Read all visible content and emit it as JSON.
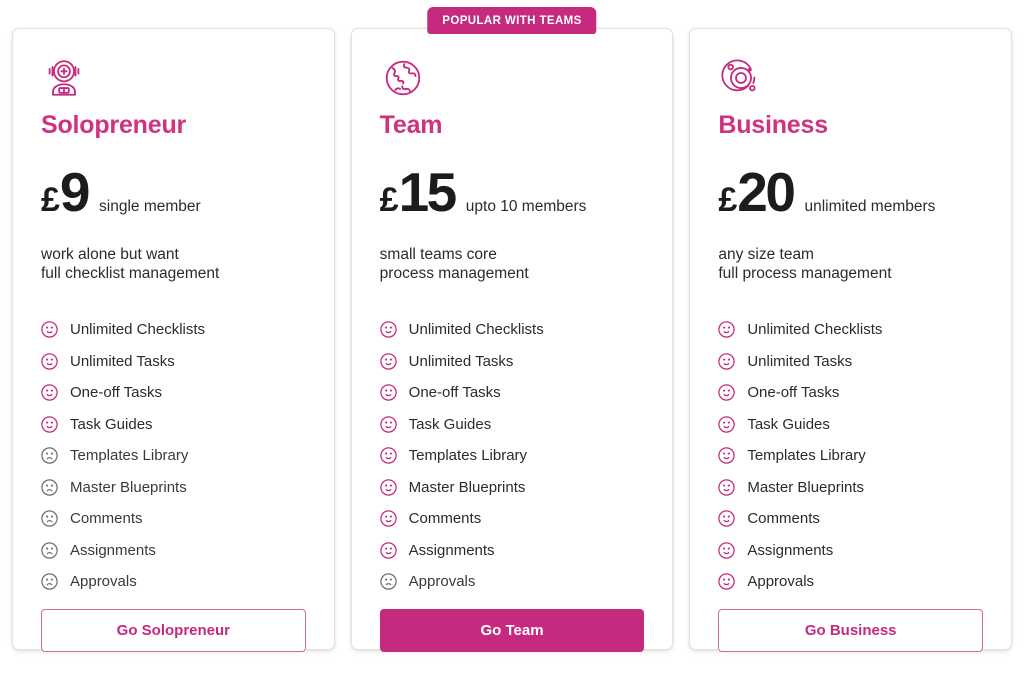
{
  "brand": {
    "accent": "#c52a7e",
    "title_color": "#cf3280",
    "text_color": "#2b2b2b",
    "muted_icon": "#6f6f6f"
  },
  "plans": [
    {
      "id": "solopreneur",
      "icon": "astronaut-helmet-icon",
      "title": "Solopreneur",
      "currency": "£",
      "amount": "9",
      "price_note": "single member",
      "tagline_line1": "work alone but want",
      "tagline_line2": "full checklist management",
      "badge": null,
      "cta_label": "Go Solopreneur",
      "cta_style": "outline",
      "features": [
        {
          "label": "Unlimited Checklists",
          "included": true
        },
        {
          "label": "Unlimited Tasks",
          "included": true
        },
        {
          "label": "One-off Tasks",
          "included": true
        },
        {
          "label": "Task Guides",
          "included": true
        },
        {
          "label": "Templates Library",
          "included": false
        },
        {
          "label": "Master Blueprints",
          "included": false
        },
        {
          "label": "Comments",
          "included": false
        },
        {
          "label": "Assignments",
          "included": false
        },
        {
          "label": "Approvals",
          "included": false
        }
      ]
    },
    {
      "id": "team",
      "icon": "globe-icon",
      "title": "Team",
      "currency": "£",
      "amount": "15",
      "price_note": "upto 10 members",
      "tagline_line1": "small teams core",
      "tagline_line2": "process management",
      "badge": "POPULAR WITH TEAMS",
      "cta_label": "Go Team",
      "cta_style": "solid",
      "features": [
        {
          "label": "Unlimited Checklists",
          "included": true
        },
        {
          "label": "Unlimited Tasks",
          "included": true
        },
        {
          "label": "One-off Tasks",
          "included": true
        },
        {
          "label": "Task Guides",
          "included": true
        },
        {
          "label": "Templates Library",
          "included": true
        },
        {
          "label": "Master Blueprints",
          "included": true
        },
        {
          "label": "Comments",
          "included": true
        },
        {
          "label": "Assignments",
          "included": true
        },
        {
          "label": "Approvals",
          "included": false
        }
      ]
    },
    {
      "id": "business",
      "icon": "orbit-icon",
      "title": "Business",
      "currency": "£",
      "amount": "20",
      "price_note": "unlimited members",
      "tagline_line1": "any size team",
      "tagline_line2": "full process management",
      "badge": null,
      "cta_label": "Go Business",
      "cta_style": "outline",
      "features": [
        {
          "label": "Unlimited Checklists",
          "included": true
        },
        {
          "label": "Unlimited Tasks",
          "included": true
        },
        {
          "label": "One-off Tasks",
          "included": true
        },
        {
          "label": "Task Guides",
          "included": true
        },
        {
          "label": "Templates Library",
          "included": true
        },
        {
          "label": "Master Blueprints",
          "included": true
        },
        {
          "label": "Comments",
          "included": true
        },
        {
          "label": "Assignments",
          "included": true
        },
        {
          "label": "Approvals",
          "included": true
        }
      ]
    }
  ]
}
